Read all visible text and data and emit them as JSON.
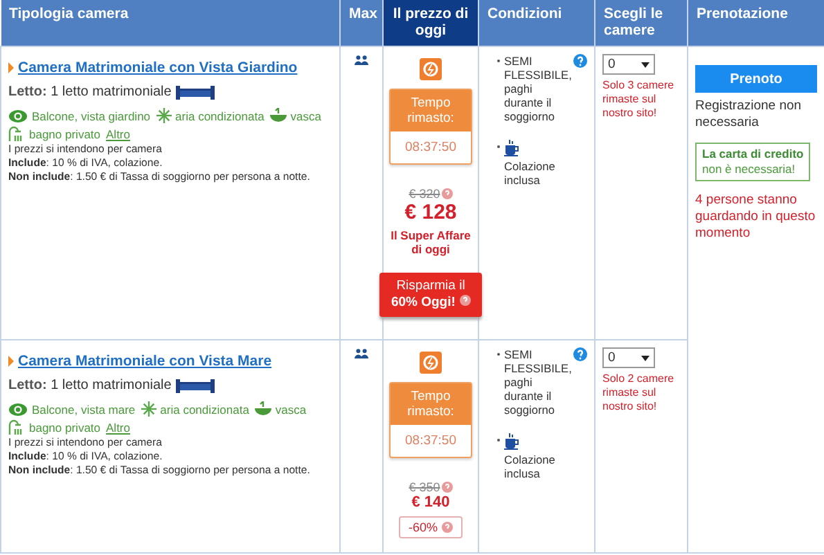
{
  "columns": [
    {
      "label": "Tipologia camera",
      "highlighted": false
    },
    {
      "label": "Max",
      "highlighted": false
    },
    {
      "label": "Il prezzo di oggi",
      "highlighted": true
    },
    {
      "label": "Condizioni",
      "highlighted": false
    },
    {
      "label": "Scegli le camere",
      "highlighted": false
    },
    {
      "label": "Prenotazione",
      "highlighted": false
    }
  ],
  "rooms": [
    {
      "name": "Camera Matrimoniale con Vista Giardino",
      "bed_label": "Letto:",
      "bed": "1 letto matrimoniale",
      "amenities": [
        {
          "kind": "view",
          "label": "Balcone, vista giardino"
        },
        {
          "kind": "ac",
          "label": "aria condizionata"
        },
        {
          "kind": "bath",
          "label": "vasca"
        },
        {
          "kind": "bathroom",
          "label": "bagno privato"
        }
      ],
      "more_link": "Altro",
      "price_note": "I prezzi si intendono per camera",
      "include": "**Include**: 10 % di IVA, colazione.",
      "exclude": "**Non include**: 1.50 € di Tassa di soggiorno per persona a notte.",
      "timer_label": "Tempo rimasto:",
      "timer": "08:37:50",
      "old_price": "€ 320",
      "price": "€ 128",
      "deal_note": "Il Super Affare di oggi",
      "savings": {
        "kind": "banner",
        "text": "Risparmia il **60% Oggi!**"
      },
      "conditions": [
        {
          "kind": "policy",
          "text": "SEMI FLESSIBILE, paghi durante il soggiorno"
        },
        {
          "kind": "breakfast",
          "text": "Colazione inclusa"
        }
      ],
      "quantity": "0",
      "availability": "Solo 3 camere rimaste sul nostro sito!"
    },
    {
      "name": "Camera Matrimoniale con Vista Mare",
      "bed_label": "Letto:",
      "bed": "1 letto matrimoniale",
      "amenities": [
        {
          "kind": "view",
          "label": "Balcone, vista mare"
        },
        {
          "kind": "ac",
          "label": "aria condizionata"
        },
        {
          "kind": "bath",
          "label": "vasca"
        },
        {
          "kind": "bathroom",
          "label": "bagno privato"
        }
      ],
      "more_link": "Altro",
      "price_note": "I prezzi si intendono per camera",
      "include": "**Include**: 10 % di IVA, colazione.",
      "exclude": "**Non include**: 1.50 € di Tassa di soggiorno per persona a notte.",
      "timer_label": "Tempo rimasto:",
      "timer": "08:37:50",
      "old_price": "€ 350",
      "price": "€ 140",
      "savings": {
        "kind": "tag",
        "text": "-60%"
      },
      "conditions": [
        {
          "kind": "policy",
          "text": "SEMI FLESSIBILE, paghi durante il soggiorno"
        },
        {
          "kind": "breakfast",
          "text": "Colazione inclusa"
        }
      ],
      "quantity": "0",
      "availability": "Solo 2 camere rimaste sul nostro sito!"
    }
  ],
  "booking": {
    "button": "Prenoto",
    "note": "Registrazione non necessaria",
    "card_title": "La carta di credito",
    "card_text": "non è necessaria!",
    "viewers": "4 persone stanno guardando in questo momento"
  }
}
